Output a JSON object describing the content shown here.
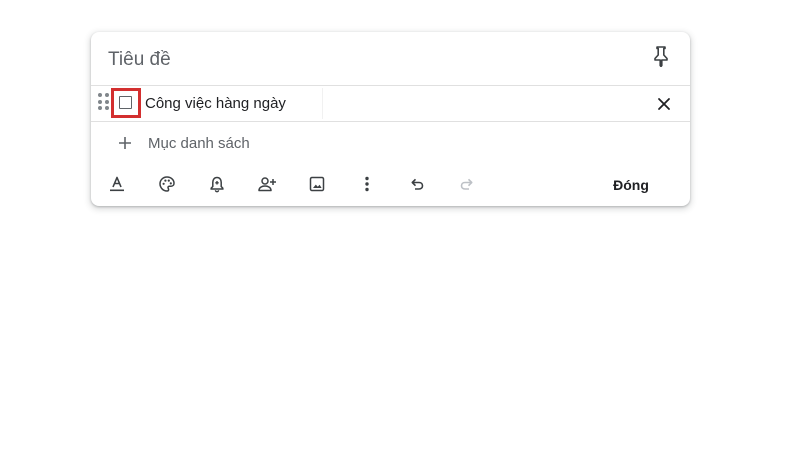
{
  "note": {
    "title_placeholder": "Tiêu đề",
    "checklist": [
      {
        "text": "Công việc hàng ngày",
        "checked": false
      }
    ],
    "add_item_placeholder": "Mục danh sách",
    "close_label": "Đóng"
  },
  "toolbar": {
    "icons": [
      "text-format-icon",
      "palette-icon",
      "reminder-bell-icon",
      "add-collaborator-icon",
      "add-image-icon",
      "more-options-icon",
      "undo-icon",
      "redo-icon"
    ]
  },
  "colors": {
    "highlight_border": "#d32f2f",
    "icon_gray": "#5f6368",
    "disabled_gray": "#bdc1c6"
  }
}
